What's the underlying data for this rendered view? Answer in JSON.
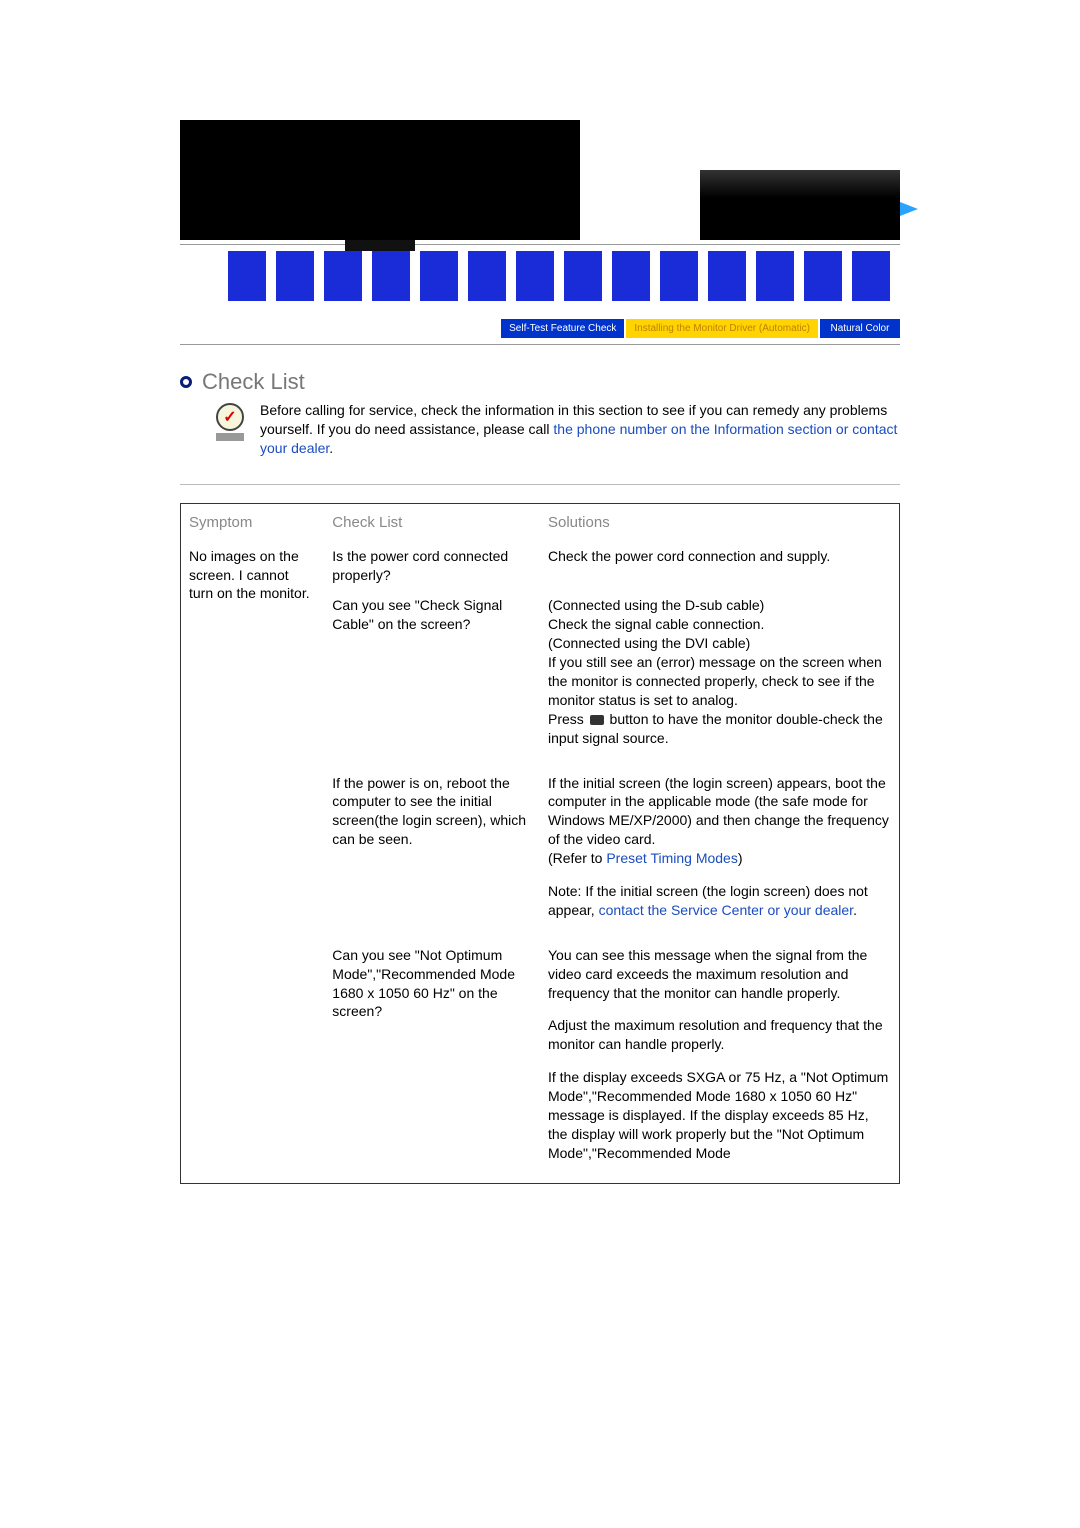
{
  "hero": {
    "big_monitor_alt": "wide-monitor-image",
    "small_monitor_alt": "monitor-rear-image"
  },
  "tabs": {
    "selected_index": 1,
    "items": [
      {
        "label": "Self-Test Feature Check"
      },
      {
        "label": "Installing the Monitor Driver (Automatic)"
      },
      {
        "label": "Natural Color"
      }
    ]
  },
  "section": {
    "title": "Check List",
    "intro_plain": "Before calling for service, check the information in this section to see if you can remedy any problems yourself. If you do need assistance, please call ",
    "intro_link": "the phone number on the Information section or contact your dealer"
  },
  "table": {
    "headers": {
      "symptom": "Symptom",
      "check": "Check List",
      "solutions": "Solutions"
    },
    "rows": [
      {
        "symptom": "No images on the screen. I cannot turn on the monitor.",
        "check": "Is the power cord connected properly?",
        "solutions": [
          {
            "text": "Check the power cord connection and supply."
          }
        ]
      },
      {
        "symptom": "",
        "check": "Can you see \"Check Signal Cable\"  on the screen?",
        "solutions": [
          {
            "text_parts": {
              "a": "(Connected using the D-sub cable)",
              "b": "Check the signal cable connection.",
              "c": "(Connected using the DVI cable)",
              "d": "If you still see an (error) message on the screen when the monitor is connected properly, check to see if the monitor status is set to analog.",
              "e_pre": "Press ",
              "e_post": " button to have the monitor double-check the input signal source."
            }
          }
        ]
      },
      {
        "symptom": "",
        "check": "If the power is on, reboot the computer to see the initial screen(the login screen), which can be seen.",
        "solutions": [
          {
            "text_pre": "If the initial screen (the login screen) appears, boot the computer in the applicable mode (the safe mode for Windows ME/XP/2000) and then change the frequency of the video card.",
            "refer": "Preset Timing Modes",
            "refer_prefix": "(Refer to "
          },
          {
            "note_pre": "Note: If the initial screen (the login screen) does not appear, ",
            "note_link": "contact the Service Center or your dealer"
          }
        ]
      },
      {
        "symptom": "",
        "check": "Can you see \"Not Optimum Mode\",\"Recommended Mode 1680 x 1050 60 Hz\"  on the screen?",
        "solutions": [
          {
            "text": "You can see this message when the signal from the video card exceeds the maximum resolution and frequency that the monitor can handle properly."
          },
          {
            "text": "Adjust the maximum resolution and frequency that the monitor can handle properly."
          },
          {
            "text": "If the display exceeds SXGA or 75 Hz, a \"Not Optimum Mode\",\"Recommended Mode 1680 x 1050 60 Hz\"  message is displayed. If the display exceeds 85 Hz, the display will work properly but the \"Not Optimum Mode\",\"Recommended Mode"
          }
        ]
      }
    ]
  }
}
